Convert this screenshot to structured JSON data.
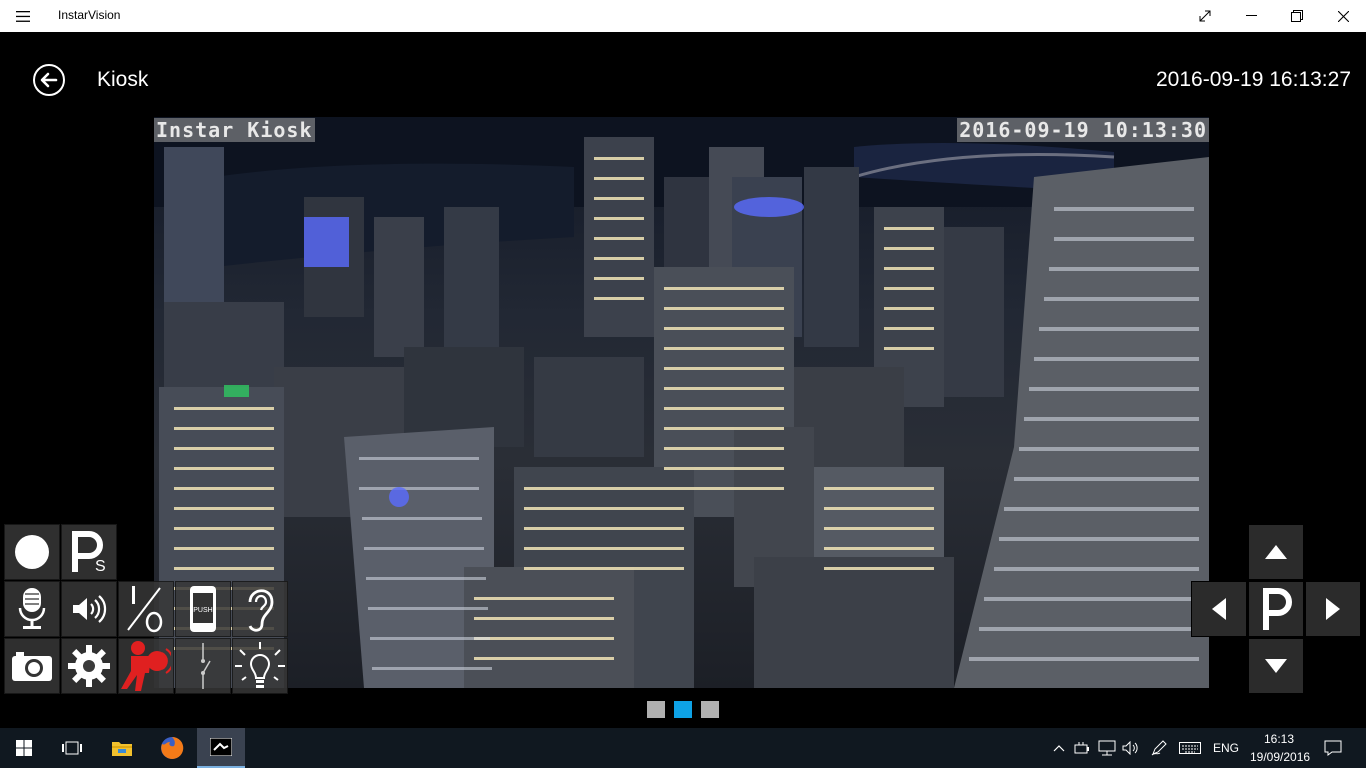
{
  "window": {
    "app_title": "InstarVision"
  },
  "header": {
    "page_title": "Kiosk",
    "datetime": "2016-09-19 16:13:27"
  },
  "camera": {
    "osd_name": "Instar Kiosk",
    "osd_timestamp": "2016-09-19 10:13:30"
  },
  "controls": {
    "left": [
      {
        "name": "record",
        "icon": "record-icon"
      },
      {
        "name": "preset",
        "icon": "preset-p-icon",
        "label": "S"
      },
      {
        "name": "microphone",
        "icon": "microphone-icon"
      },
      {
        "name": "speaker",
        "icon": "speaker-icon"
      },
      {
        "name": "io",
        "icon": "io-toggle-icon"
      },
      {
        "name": "push",
        "icon": "push-phone-icon",
        "label": "PUSH"
      },
      {
        "name": "listen",
        "icon": "ear-icon"
      },
      {
        "name": "snapshot",
        "icon": "camera-icon"
      },
      {
        "name": "settings",
        "icon": "gear-icon"
      },
      {
        "name": "alarm",
        "icon": "alarm-burglar-icon"
      },
      {
        "name": "switch",
        "icon": "switch-icon"
      },
      {
        "name": "light",
        "icon": "light-bulb-icon"
      }
    ],
    "ptz": [
      {
        "name": "up",
        "icon": "arrow-up-icon"
      },
      {
        "name": "left",
        "icon": "arrow-left-icon"
      },
      {
        "name": "preset",
        "icon": "preset-p-icon",
        "label": "P"
      },
      {
        "name": "right",
        "icon": "arrow-right-icon"
      },
      {
        "name": "down",
        "icon": "arrow-down-icon"
      }
    ]
  },
  "pagination": {
    "pages": 3,
    "active_index": 1
  },
  "colors": {
    "accent": "#0ea2e6",
    "alarm": "#e02020"
  },
  "taskbar": {
    "language": "ENG",
    "time": "16:13",
    "date": "19/09/2016"
  }
}
